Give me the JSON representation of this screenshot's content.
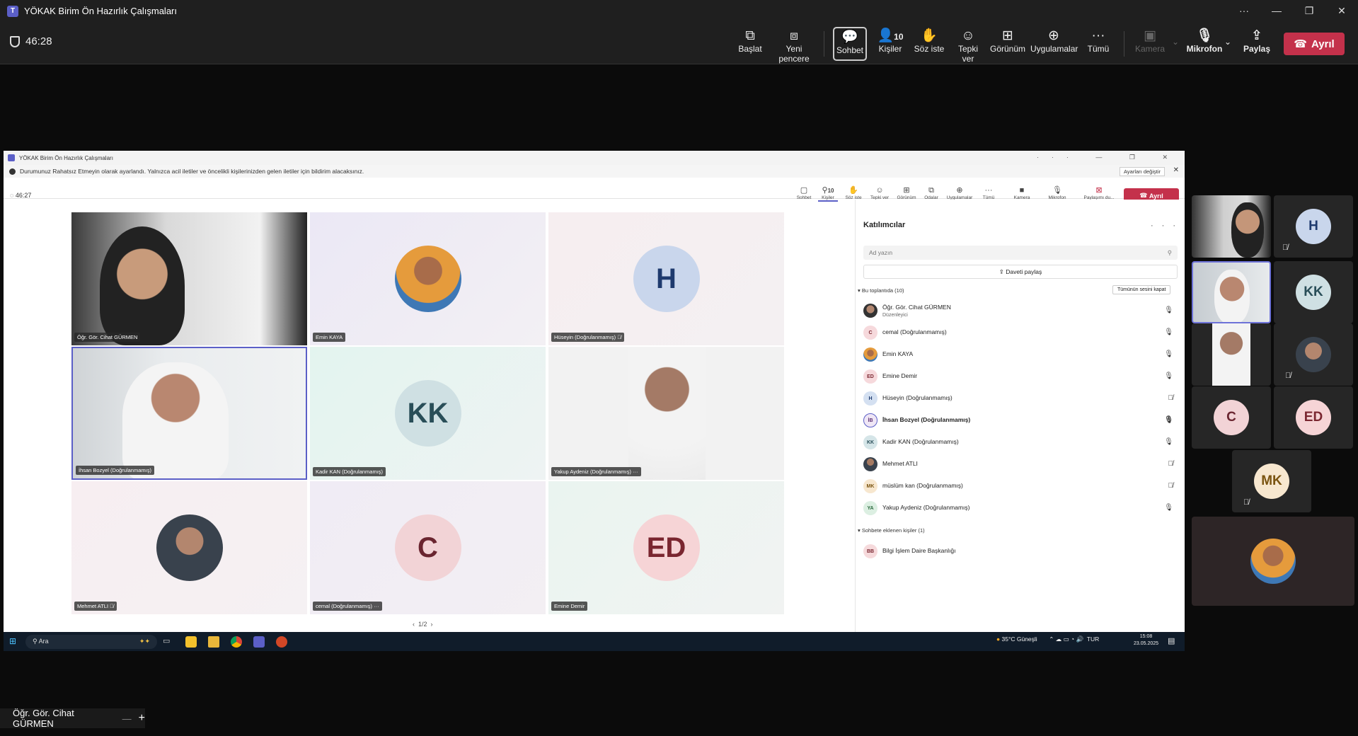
{
  "window": {
    "title": "YÖKAK Birim Ön Hazırlık Çalışmaları",
    "controls": [
      "···",
      "—",
      "❐",
      "✕"
    ]
  },
  "toolbar": {
    "timer": "46:28",
    "buttons": {
      "start": "Başlat",
      "new_window": "Yeni pencere",
      "chat": "Sohbet",
      "people": "Kişiler",
      "people_count": "10",
      "raise_hand": "Söz iste",
      "react": "Tepki ver",
      "view": "Görünüm",
      "apps": "Uygulamalar",
      "more": "Tümü",
      "camera": "Kamera",
      "mic": "Mikrofon",
      "share": "Paylaş",
      "leave": "Ayrıl"
    }
  },
  "inner": {
    "title": "YÖKAK Birim Ön Hazırlık Çalışmaları",
    "banner": "Durumunuz Rahatsız Etmeyin olarak ayarlandı. Yalnızca acil iletiler ve öncelikli kişilerinizden gelen iletiler için bildirim alacaksınız.",
    "banner_button": "Ayarları değiştir",
    "timer": "46:27",
    "toolbar": {
      "chat": "Sohbet",
      "people": "Kişiler",
      "people_count": "10",
      "raise_hand": "Söz iste",
      "react": "Tepki ver",
      "view": "Görünüm",
      "rooms": "Odalar",
      "apps": "Uygulamalar",
      "more": "Tümü",
      "camera": "Kamera",
      "mic": "Mikrofon",
      "stop_share": "Paylaşımı du...",
      "leave": "Ayrıl"
    },
    "tiles": [
      {
        "name": "Öğr. Gör. Cihat GÜRMEN"
      },
      {
        "name": "Emin KAYA"
      },
      {
        "name": "Hüseyin (Doğrulanmamış)",
        "initials": "H"
      },
      {
        "name": "İhsan Bozyel (Doğrulanmamış)"
      },
      {
        "name": "Kadir KAN (Doğrulanmamış)",
        "initials": "KK"
      },
      {
        "name": "Yakup Aydeniz (Doğrulanmamış)"
      },
      {
        "name": "Mehmet ATLI"
      },
      {
        "name": "cemal (Doğrulanmamış)",
        "initials": "C"
      },
      {
        "name": "Emine Demir",
        "initials": "ED"
      }
    ],
    "pager": "1/2",
    "panel": {
      "title": "Katılımcılar",
      "search_placeholder": "Ad yazın",
      "invite": "Daveti paylaş",
      "section_meeting": "Bu toplantıda (10)",
      "mute_all": "Tümünün sesini kapat",
      "participants": [
        {
          "name": "Öğr. Gör. Cihat GÜRMEN",
          "role": "Düzenleyici",
          "initials": ""
        },
        {
          "name": "cemal (Doğrulanmamış)",
          "initials": "C"
        },
        {
          "name": "Emin KAYA",
          "initials": ""
        },
        {
          "name": "Emine Demir",
          "initials": "ED"
        },
        {
          "name": "Hüseyin (Doğrulanmamış)",
          "initials": "H"
        },
        {
          "name": "İhsan Bozyel (Doğrulanmamış)",
          "initials": "İB"
        },
        {
          "name": "Kadir KAN (Doğrulanmamış)",
          "initials": "KK"
        },
        {
          "name": "Mehmet ATLI",
          "initials": ""
        },
        {
          "name": "müslüm kan (Doğrulanmamış)",
          "initials": "MK"
        },
        {
          "name": "Yakup Aydeniz (Doğrulanmamış)",
          "initials": "YA"
        }
      ],
      "section_chat": "Sohbete eklenen kişiler (1)",
      "chat_people": [
        {
          "name": "Bilgi İşlem Daire Başkanlığı",
          "initials": "BB"
        }
      ]
    },
    "taskbar": {
      "search": "Ara",
      "weather": "35°C  Güneşli",
      "lang": "TUR",
      "time": "15:08",
      "date": "23.05.2025"
    }
  },
  "gallery": {
    "initials": [
      "H",
      "KK",
      "C",
      "ED",
      "MK"
    ]
  },
  "bottom": {
    "name": "Öğr. Gör. Cihat GÜRMEN"
  },
  "colors": {
    "accent": "#5b5fc7",
    "leave": "#c4314b"
  }
}
